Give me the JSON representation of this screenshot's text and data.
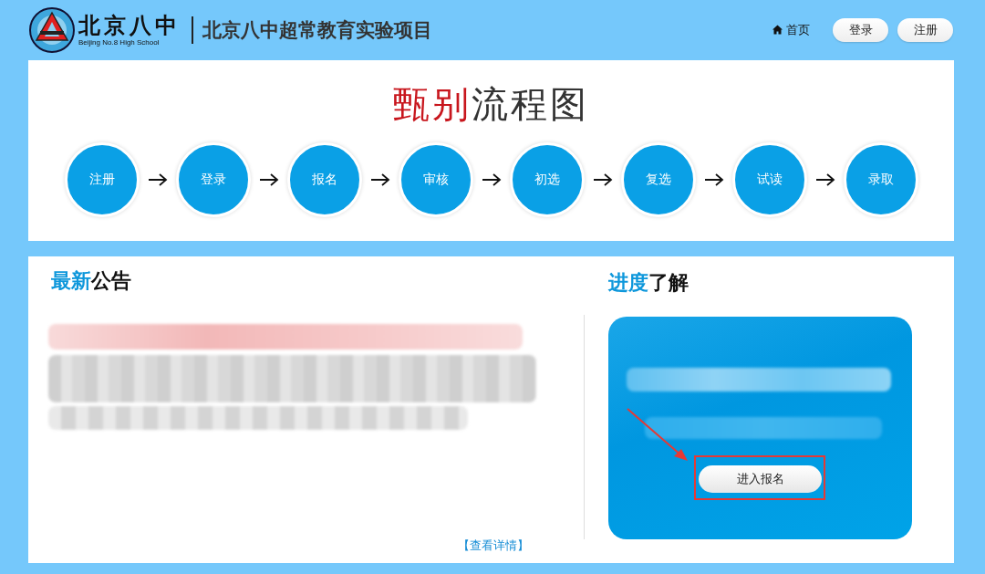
{
  "header": {
    "logo_name": "北京八中",
    "logo_subtitle": "Beijing No.8 High School",
    "site_title": "北京八中超常教育实验项目",
    "nav": [
      {
        "kind": "link",
        "label": "首页"
      },
      {
        "kind": "button",
        "label": "登录"
      },
      {
        "kind": "button",
        "label": "注册"
      }
    ]
  },
  "flow": {
    "title_accent": "甄别",
    "title_rest": "流程图",
    "steps": [
      "注册",
      "登录",
      "报名",
      "审核",
      "初选",
      "复选",
      "试读",
      "录取"
    ]
  },
  "notices": {
    "title_accent": "最新",
    "title_rest": "公告",
    "more_link": "【查看详情】"
  },
  "progress": {
    "title_accent": "进度",
    "title_rest": "了解",
    "button": "进入报名"
  }
}
